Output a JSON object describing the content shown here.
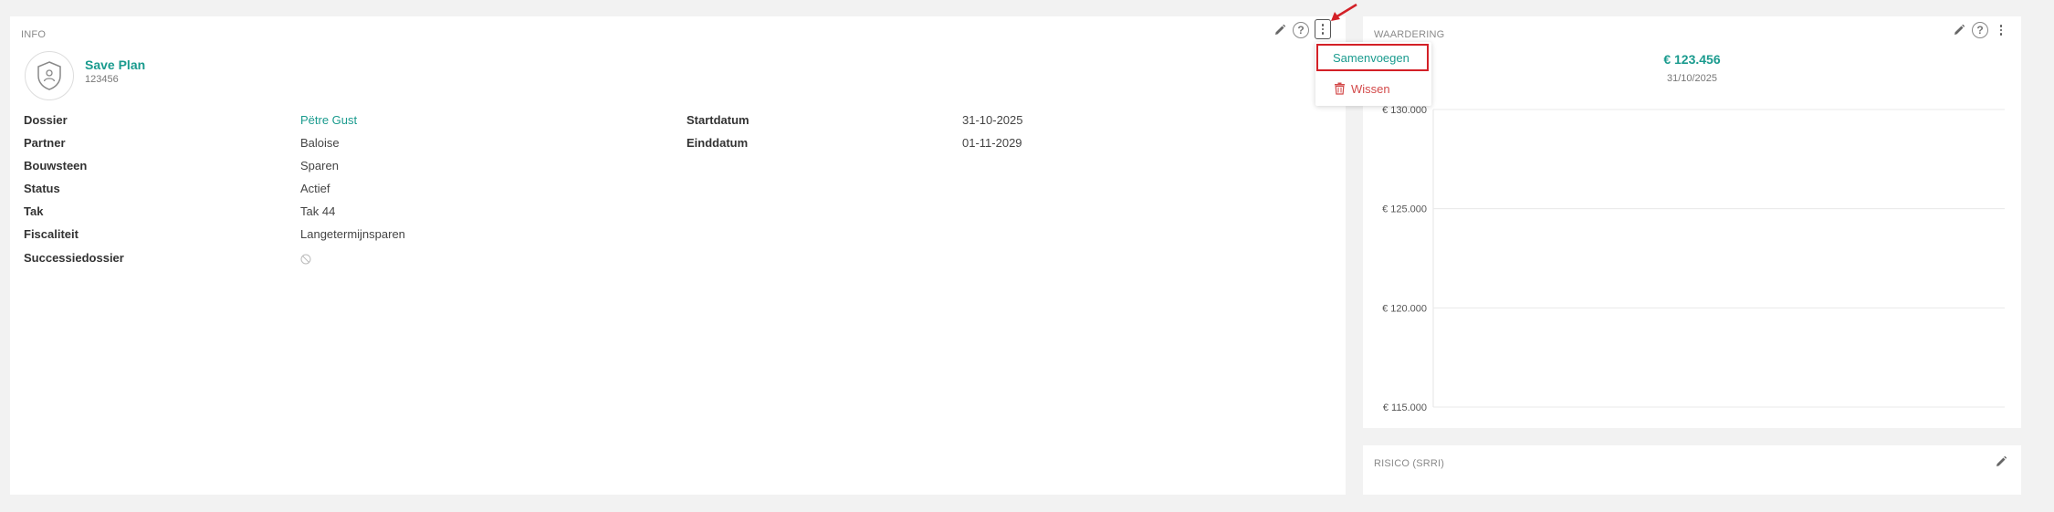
{
  "info": {
    "title": "INFO",
    "plan_name": "Save Plan",
    "plan_number": "123456",
    "fields_left": [
      {
        "label": "Dossier",
        "value": "Pëtre Gust",
        "is_link": true
      },
      {
        "label": "Partner",
        "value": "Baloise"
      },
      {
        "label": "Bouwsteen",
        "value": "Sparen"
      },
      {
        "label": "Status",
        "value": "Actief"
      },
      {
        "label": "Tak",
        "value": "Tak 44"
      },
      {
        "label": "Fiscaliteit",
        "value": "Langetermijnsparen"
      },
      {
        "label": "Successiedossier",
        "value": ""
      }
    ],
    "fields_right": [
      {
        "label": "Startdatum",
        "value": "31-10-2025"
      },
      {
        "label": "Einddatum",
        "value": "01-11-2029"
      }
    ]
  },
  "menu": {
    "items": [
      {
        "label": "Samenvoegen",
        "highlighted": true
      },
      {
        "label": "Wissen",
        "icon": "trash-icon"
      }
    ]
  },
  "valuation": {
    "title": "WAARDERING",
    "amount": "€ 123.456",
    "date": "31/10/2025"
  },
  "risk": {
    "title": "RISICO (SRRI)"
  },
  "chart_data": {
    "type": "line",
    "title": "",
    "xlabel": "",
    "ylabel": "",
    "ylim": [
      115000,
      130000
    ],
    "yticks": [
      130000,
      125000,
      120000,
      115000
    ],
    "ytick_labels": [
      "€ 130.000",
      "€ 125.000",
      "€ 120.000",
      "€ 115.000"
    ],
    "series": [],
    "grid": true
  },
  "colors": {
    "accent": "#1a9b8e",
    "danger": "#d34a4a",
    "highlight_border": "#d32027"
  }
}
